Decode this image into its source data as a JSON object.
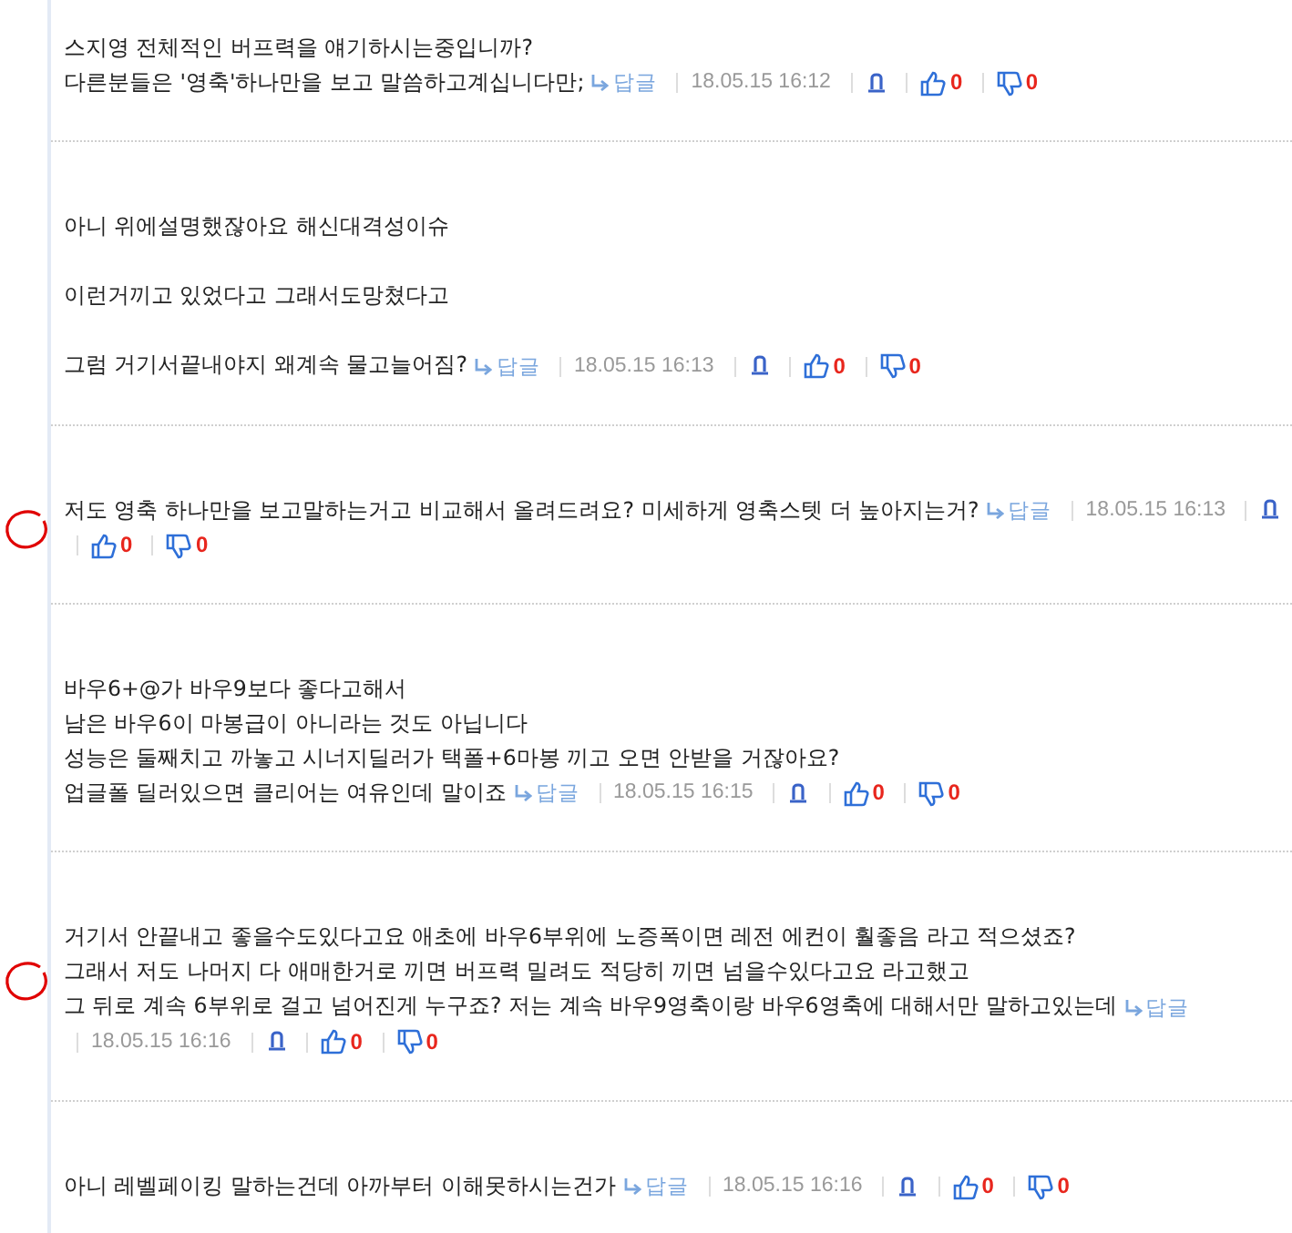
{
  "comments": [
    {
      "annotated": false,
      "paragraphs": [
        [
          "스지영 전체적인 버프력을 얘기하시는중입니까?",
          "다른분들은 '영축'하나만을 보고 말씀하고계십니다만;"
        ]
      ],
      "reply": "답글",
      "time": "18.05.15 16:12",
      "likes": "0",
      "dislikes": "0"
    },
    {
      "annotated": false,
      "paragraphs": [
        [
          "아니 위에설명했잖아요 해신대격성이슈"
        ],
        [
          "이런거끼고 있었다고 그래서도망쳤다고"
        ],
        [
          "그럼 거기서끝내야지 왜계속 물고늘어짐?"
        ]
      ],
      "reply": "답글",
      "time": "18.05.15 16:13",
      "likes": "0",
      "dislikes": "0"
    },
    {
      "annotated": true,
      "paragraphs": [
        [
          "저도 영축 하나만을 보고말하는거고 비교해서 올려드려요? 미세하게 영축스텟 더 높아지는거?"
        ]
      ],
      "reply": "답글",
      "time": "18.05.15 16:13",
      "likes": "0",
      "dislikes": "0"
    },
    {
      "annotated": false,
      "paragraphs": [
        [
          "바우6+@가 바우9보다 좋다고해서",
          "남은 바우6이 마봉급이 아니라는 것도 아닙니다",
          "성능은 둘째치고 까놓고 시너지딜러가 택폴+6마봉 끼고 오면 안받을 거잖아요?",
          "업글폴 딜러있으면 클리어는 여유인데 말이죠"
        ]
      ],
      "reply": "답글",
      "time": "18.05.15 16:15",
      "likes": "0",
      "dislikes": "0"
    },
    {
      "annotated": true,
      "paragraphs": [
        [
          "거기서 안끝내고 좋을수도있다고요 애초에 바우6부위에 노증폭이면 레전 에컨이 훨좋음 라고 적으셨죠?",
          "그래서 저도 나머지 다 애매한거로 끼면 버프력 밀려도 적당히 끼면 넘을수있다고요 라고했고",
          "그 뒤로 계속 6부위로 걸고 넘어진게 누구죠? 저는 계속 바우9영축이랑 바우6영축에 대해서만 말하고있는데"
        ]
      ],
      "reply": "답글",
      "time": "18.05.15 16:16",
      "likes": "0",
      "dislikes": "0"
    },
    {
      "annotated": false,
      "paragraphs": [
        [
          "아니 레벨페이킹 말하는건데 아까부터 이해못하시는건가"
        ]
      ],
      "reply": "답글",
      "time": "18.05.15 16:16",
      "likes": "0",
      "dislikes": "0"
    }
  ]
}
